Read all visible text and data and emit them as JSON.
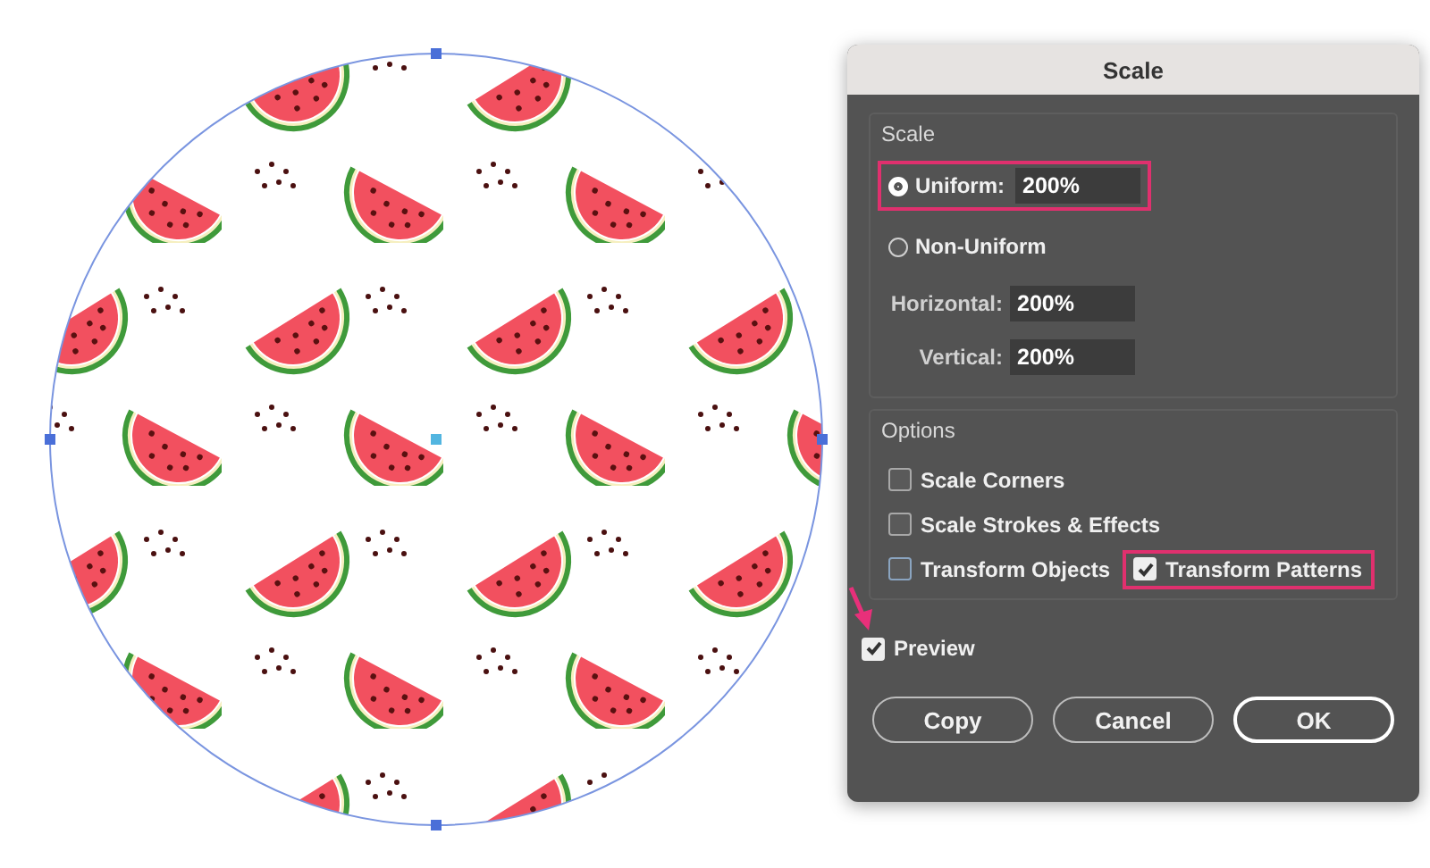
{
  "dialog": {
    "title": "Scale",
    "scale_group": {
      "heading": "Scale",
      "uniform": {
        "label": "Uniform:",
        "value": "200%",
        "selected": true,
        "highlighted": true
      },
      "non_uniform": {
        "label": "Non-Uniform",
        "selected": false
      },
      "fields": [
        {
          "label": "Horizontal:",
          "value": "200%"
        },
        {
          "label": "Vertical:",
          "value": "200%"
        }
      ]
    },
    "options_group": {
      "heading": "Options",
      "rows": [
        [
          {
            "label": "Scale Corners",
            "checked": false,
            "focused": false,
            "highlighted": false
          }
        ],
        [
          {
            "label": "Scale Strokes & Effects",
            "checked": false,
            "focused": false,
            "highlighted": false
          }
        ],
        [
          {
            "label": "Transform Objects",
            "checked": false,
            "focused": true,
            "highlighted": false
          },
          {
            "label": "Transform Patterns",
            "checked": true,
            "focused": false,
            "highlighted": true
          }
        ]
      ]
    },
    "preview": {
      "label": "Preview",
      "checked": true,
      "pointed_at": true
    },
    "buttons": [
      {
        "label": "Copy",
        "default": false
      },
      {
        "label": "Cancel",
        "default": false
      },
      {
        "label": "OK",
        "default": true
      }
    ]
  }
}
